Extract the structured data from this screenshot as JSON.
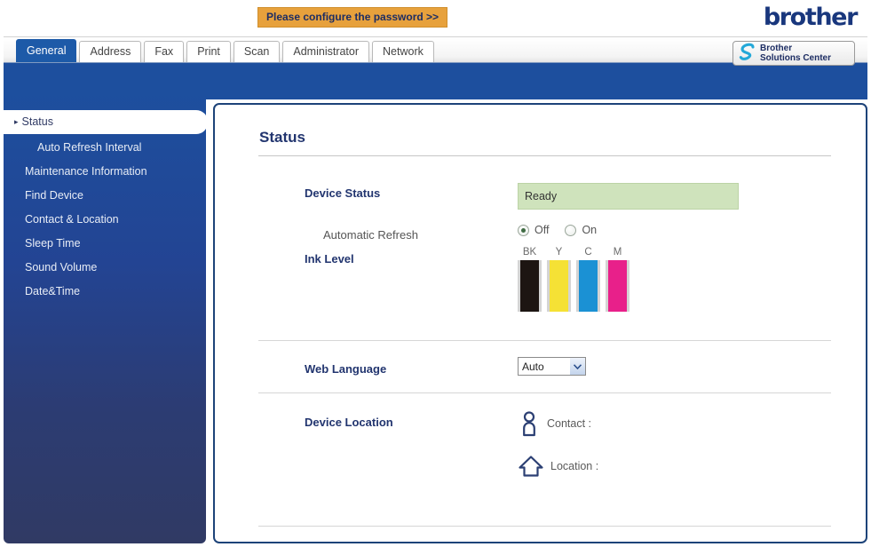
{
  "header": {
    "password_banner": "Please configure the password >>",
    "brand_logo": "brother",
    "solutions_center_line1": "Brother",
    "solutions_center_line2": "Solutions Center"
  },
  "tabs": [
    {
      "label": "General",
      "active": true
    },
    {
      "label": "Address",
      "active": false
    },
    {
      "label": "Fax",
      "active": false
    },
    {
      "label": "Print",
      "active": false
    },
    {
      "label": "Scan",
      "active": false
    },
    {
      "label": "Administrator",
      "active": false
    },
    {
      "label": "Network",
      "active": false
    }
  ],
  "sidebar": {
    "items": [
      {
        "label": "Status",
        "active": true,
        "sub": false,
        "bullet": "▸"
      },
      {
        "label": "Auto Refresh Interval",
        "active": false,
        "sub": true
      },
      {
        "label": "Maintenance Information",
        "active": false,
        "sub": false
      },
      {
        "label": "Find Device",
        "active": false,
        "sub": false
      },
      {
        "label": "Contact & Location",
        "active": false,
        "sub": false
      },
      {
        "label": "Sleep Time",
        "active": false,
        "sub": false
      },
      {
        "label": "Sound Volume",
        "active": false,
        "sub": false
      },
      {
        "label": "Date&Time",
        "active": false,
        "sub": false
      }
    ]
  },
  "main": {
    "title": "Status",
    "device_status": {
      "label": "Device Status",
      "value": "Ready",
      "value_bg": "#cfe3bc"
    },
    "automatic_refresh": {
      "label": "Automatic Refresh",
      "options": [
        {
          "label": "Off",
          "selected": true
        },
        {
          "label": "On",
          "selected": false
        }
      ]
    },
    "ink_level": {
      "label": "Ink Level",
      "cartridges": [
        {
          "code": "BK",
          "name": "black",
          "color": "#1d1512",
          "percent": 100
        },
        {
          "code": "Y",
          "name": "yellow",
          "color": "#f5e135",
          "percent": 100
        },
        {
          "code": "C",
          "name": "cyan",
          "color": "#1b91d4",
          "percent": 100
        },
        {
          "code": "M",
          "name": "magenta",
          "color": "#e8208a",
          "percent": 100
        }
      ]
    },
    "web_language": {
      "label": "Web Language",
      "value": "Auto"
    },
    "device_location": {
      "label": "Device Location",
      "contact_label": "Contact :",
      "contact_value": "",
      "location_label": "Location :",
      "location_value": ""
    }
  }
}
